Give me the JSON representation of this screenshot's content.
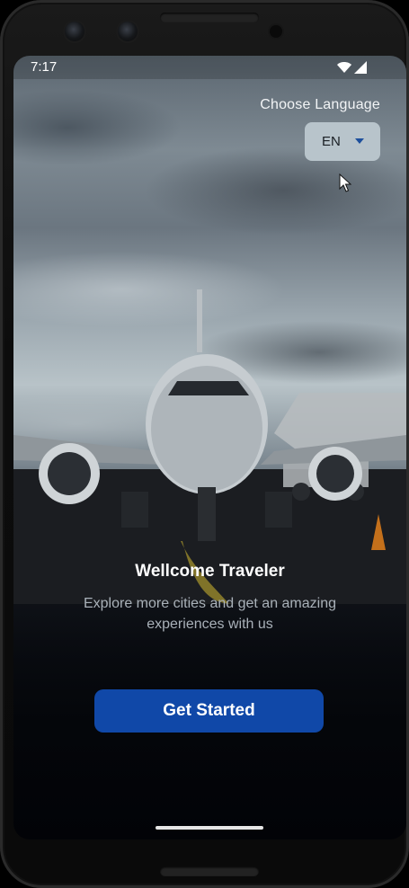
{
  "status_bar": {
    "time": "7:17"
  },
  "language": {
    "label": "Choose Language",
    "selected": "EN"
  },
  "welcome": {
    "title": "Wellcome Traveler",
    "subtitle": "Explore more cities and get an amazing experiences with us"
  },
  "cta": {
    "label": "Get Started"
  },
  "colors": {
    "button": "#1048a8",
    "dropdown_bg": "#b8c4cb",
    "dropdown_arrow": "#1d4f9c"
  },
  "icons": [
    "wifi-icon",
    "signal-icon",
    "dropdown-arrow-icon",
    "mouse-cursor-icon"
  ]
}
